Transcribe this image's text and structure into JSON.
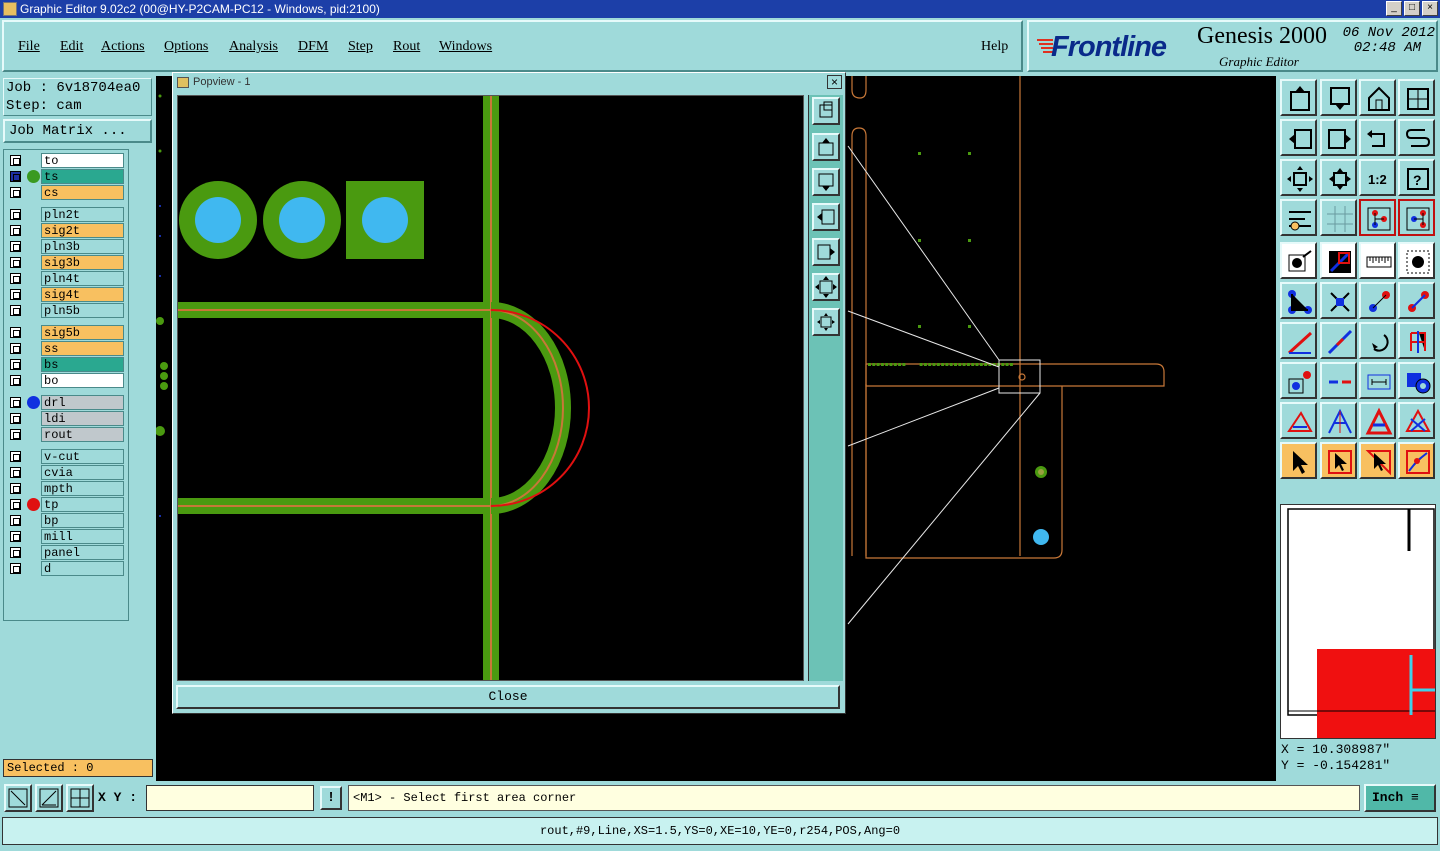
{
  "window": {
    "title": "Graphic Editor 9.02c2 (00@HY-P2CAM-PC12 - Windows, pid:2100)",
    "min": "_",
    "max": "□",
    "close": "×"
  },
  "menu": {
    "items": [
      "File",
      "Edit",
      "Actions",
      "Options",
      "Analysis",
      "DFM",
      "Step",
      "Rout",
      "Windows"
    ],
    "help": "Help"
  },
  "brand": {
    "logo": "Frontline",
    "product": "Genesis 2000",
    "subtitle": "Graphic Editor",
    "date": "06 Nov 2012",
    "time": "02:48 AM"
  },
  "job": {
    "job_line": "Job : 6v18704ea0",
    "step_line": "Step: cam",
    "matrix_button": "Job Matrix ..."
  },
  "layers": [
    {
      "name": "to",
      "bg": "#ffffff",
      "marker": null,
      "group": 0
    },
    {
      "name": "ts",
      "bg": "#2aa890",
      "marker": "#3a9a20",
      "group": 0,
      "active": true
    },
    {
      "name": "cs",
      "bg": "#f8c060",
      "marker": null,
      "group": 0
    },
    {
      "name": "pln2t",
      "bg": "#9fdada",
      "marker": null,
      "group": 1
    },
    {
      "name": "sig2t",
      "bg": "#f8c060",
      "marker": null,
      "group": 1
    },
    {
      "name": "pln3b",
      "bg": "#9fdada",
      "marker": null,
      "group": 1
    },
    {
      "name": "sig3b",
      "bg": "#f8c060",
      "marker": null,
      "group": 1
    },
    {
      "name": "pln4t",
      "bg": "#9fdada",
      "marker": null,
      "group": 1
    },
    {
      "name": "sig4t",
      "bg": "#f8c060",
      "marker": null,
      "group": 1
    },
    {
      "name": "pln5b",
      "bg": "#9fdada",
      "marker": null,
      "group": 1
    },
    {
      "name": "sig5b",
      "bg": "#f8c060",
      "marker": null,
      "group": 2
    },
    {
      "name": "ss",
      "bg": "#f8c060",
      "marker": null,
      "group": 2
    },
    {
      "name": "bs",
      "bg": "#2aa890",
      "marker": null,
      "group": 2
    },
    {
      "name": "bo",
      "bg": "#ffffff",
      "marker": null,
      "group": 2
    },
    {
      "name": "drl",
      "bg": "#c0c8cc",
      "marker": "#1030e0",
      "group": 3
    },
    {
      "name": "ldi",
      "bg": "#c0c8cc",
      "marker": null,
      "group": 3
    },
    {
      "name": "rout",
      "bg": "#c0c8cc",
      "marker": null,
      "group": 3
    },
    {
      "name": "v-cut",
      "bg": "#9fdada",
      "marker": null,
      "group": 4
    },
    {
      "name": "cvia",
      "bg": "#9fdada",
      "marker": null,
      "group": 4
    },
    {
      "name": "mpth",
      "bg": "#9fdada",
      "marker": null,
      "group": 4
    },
    {
      "name": "tp",
      "bg": "#9fdada",
      "marker": "#e01010",
      "group": 4
    },
    {
      "name": "bp",
      "bg": "#9fdada",
      "marker": null,
      "group": 4
    },
    {
      "name": "mill",
      "bg": "#9fdada",
      "marker": null,
      "group": 4
    },
    {
      "name": "panel",
      "bg": "#9fdada",
      "marker": null,
      "group": 4
    },
    {
      "name": "d",
      "bg": "#9fdada",
      "marker": null,
      "group": 4
    }
  ],
  "selected_text": "Selected : 0",
  "popview": {
    "title": "Popview - 1",
    "close_button": "Close"
  },
  "coords": {
    "x_line": "X = 10.308987\"",
    "y_line": "Y = -0.154281\""
  },
  "bottom": {
    "xy_label": "X Y :",
    "xy_value": "",
    "exclaim": "!",
    "prompt": "<M1> - Select first area corner",
    "unit": "Inch"
  },
  "status": "rout,#9,Line,XS=1.5,YS=0,XE=10,YE=0,r254,POS,Ang=0",
  "toolbar_icons": [
    "zoom-home-icon",
    "zoom-down-icon",
    "home-icon",
    "window-split-icon",
    "pan-left-icon",
    "pan-right-icon",
    "undo-icon",
    "snake-icon",
    "fit-screen-icon",
    "center-icon",
    "scale-1-2-icon",
    "help-icon",
    "tools-icon",
    "grid-icon",
    "feature-select-icon",
    "feature-select-red-icon",
    "arrow-pad-icon",
    "diagonal-red-icon",
    "ruler-icon",
    "dotted-pad-icon",
    "connect-icon",
    "cross-icon",
    "line-pad-icon",
    "line-red-pad-icon",
    "angle-icon",
    "slash-icon",
    "rotate-icon",
    "mirror-icon",
    "pad-select-icon",
    "line-split-icon",
    "dimension-icon",
    "pad-blue-icon",
    "triangle-icon",
    "triangle-outline-icon",
    "triangle-arrow-icon",
    "triangle-cross-icon",
    "pointer-icon",
    "pointer-box-icon",
    "pointer-outline-icon",
    "route-icon"
  ],
  "colors": {
    "panel": "#9fdada",
    "tool_orange": "#f8c060",
    "trace_green": "#4a9a10",
    "pad_blue": "#40b8f0",
    "rout_orange": "#c87838",
    "arc_red": "#e01010"
  }
}
